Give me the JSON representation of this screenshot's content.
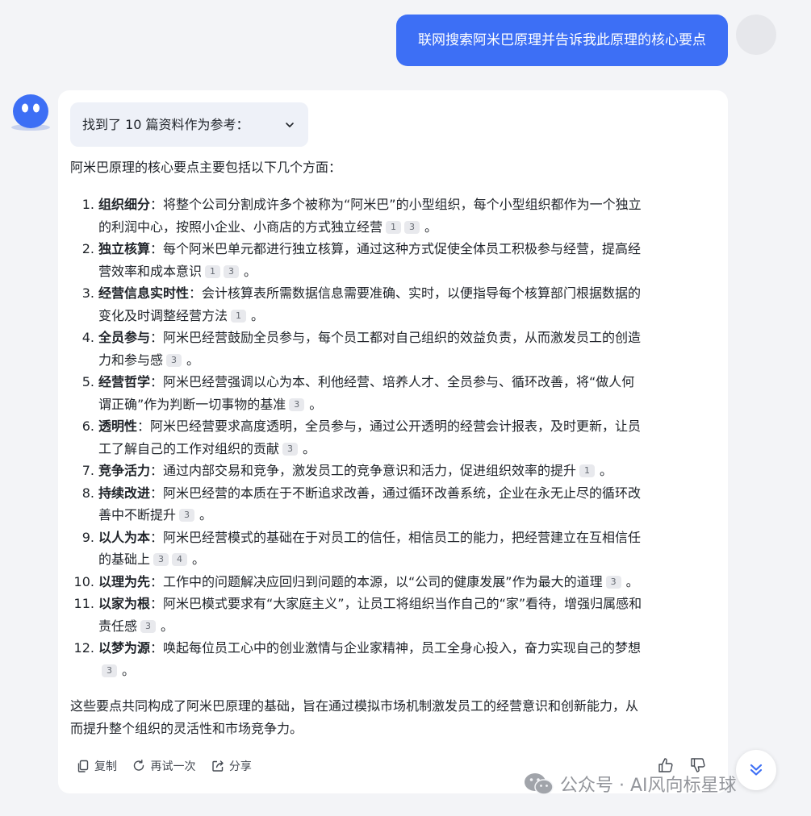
{
  "user_message": "联网搜索阿米巴原理并告诉我此原理的核心要点",
  "references": {
    "label": "找到了 10 篇资料作为参考："
  },
  "answer": {
    "intro": "阿米巴原理的核心要点主要包括以下几个方面：",
    "items": [
      {
        "num": "1.",
        "title": "组织细分",
        "lines": [
          "：将整个公司分割成许多个被称为“阿米巴”的小型组织，每个小型组织都作为一个独立",
          "的利润中心，按照小企业、小商店的方式独立经营"
        ],
        "cites": [
          "1",
          "3"
        ]
      },
      {
        "num": "2.",
        "title": "独立核算",
        "lines": [
          "：每个阿米巴单元都进行独立核算，通过这种方式促使全体员工积极参与经营，提高经",
          "营效率和成本意识"
        ],
        "cites": [
          "1",
          "3"
        ]
      },
      {
        "num": "3.",
        "title": "经营信息实时性",
        "lines": [
          "：会计核算表所需数据信息需要准确、实时，以便指导每个核算部门根据数据的",
          "变化及时调整经营方法"
        ],
        "cites": [
          "1"
        ]
      },
      {
        "num": "4.",
        "title": "全员参与",
        "lines": [
          "：阿米巴经营鼓励全员参与，每个员工都对自己组织的效益负责，从而激发员工的创造",
          "力和参与感"
        ],
        "cites": [
          "3"
        ]
      },
      {
        "num": "5.",
        "title": "经营哲学",
        "lines": [
          "：阿米巴经营强调以心为本、利他经营、培养人才、全员参与、循环改善，将“做人何",
          "谓正确”作为判断一切事物的基准"
        ],
        "cites": [
          "3"
        ]
      },
      {
        "num": "6.",
        "title": "透明性",
        "lines": [
          "：阿米巴经营要求高度透明，全员参与，通过公开透明的经营会计报表，及时更新，让员",
          "工了解自己的工作对组织的贡献"
        ],
        "cites": [
          "3"
        ]
      },
      {
        "num": "7.",
        "title": "竞争活力",
        "lines": [
          "：通过内部交易和竞争，激发员工的竞争意识和活力，促进组织效率的提升"
        ],
        "cites": [
          "1"
        ]
      },
      {
        "num": "8.",
        "title": "持续改进",
        "lines": [
          "：阿米巴经营的本质在于不断追求改善，通过循环改善系统，企业在永无止尽的循环改",
          "善中不断提升"
        ],
        "cites": [
          "3"
        ]
      },
      {
        "num": "9.",
        "title": "以人为本",
        "lines": [
          "：阿米巴经营模式的基础在于对员工的信任，相信员工的能力，把经营建立在互相信任",
          "的基础上"
        ],
        "cites": [
          "3",
          "4"
        ]
      },
      {
        "num": "10.",
        "title": "以理为先",
        "lines": [
          "：工作中的问题解决应回归到问题的本源，以“公司的健康发展”作为最大的道理"
        ],
        "cites": [
          "3"
        ]
      },
      {
        "num": "11.",
        "title": "以家为根",
        "lines": [
          "：阿米巴模式要求有“大家庭主义”，让员工将组织当作自己的“家”看待，增强归属感和",
          "责任感"
        ],
        "cites": [
          "3"
        ]
      },
      {
        "num": "12.",
        "title": "以梦为源",
        "lines": [
          "：唤起每位员工心中的创业激情与企业家精神，员工全身心投入，奋力实现自己的梦想",
          ""
        ],
        "cites": [
          "3"
        ]
      }
    ],
    "summary_lines": [
      "这些要点共同构成了阿米巴原理的基础，旨在通过模拟市场机制激发员工的经营意识和创新能力，从",
      "而提升整个组织的灵活性和市场竞争力。"
    ],
    "end_mark": "。"
  },
  "actions": {
    "copy": "复制",
    "retry": "再试一次",
    "share": "分享"
  },
  "watermark": "公众号 · AI风向标星球",
  "colors": {
    "user_bubble": "#3d6ff5",
    "page_bg": "#f3f4f7",
    "cite_bg": "#e8e9ed"
  }
}
